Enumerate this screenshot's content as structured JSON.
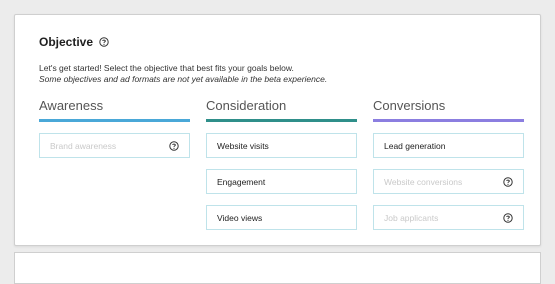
{
  "section": {
    "title": "Objective",
    "intro": "Let's get started! Select the objective that best fits your goals below.",
    "note": "Some objectives and ad formats are not yet available in the beta experience."
  },
  "columns": [
    {
      "header": "Awareness",
      "accent": "#4aa8d8",
      "options": [
        {
          "label": "Brand awareness",
          "disabled": true,
          "icon": "help-circle-icon"
        }
      ]
    },
    {
      "header": "Consideration",
      "accent": "#2f8f8a",
      "options": [
        {
          "label": "Website visits",
          "disabled": false
        },
        {
          "label": "Engagement",
          "disabled": false
        },
        {
          "label": "Video views",
          "disabled": false
        }
      ]
    },
    {
      "header": "Conversions",
      "accent": "#8b7ee0",
      "options": [
        {
          "label": "Lead generation",
          "disabled": false
        },
        {
          "label": "Website conversions",
          "disabled": true,
          "icon": "help-circle-icon"
        },
        {
          "label": "Job applicants",
          "disabled": true,
          "icon": "help-circle-icon"
        }
      ]
    }
  ]
}
